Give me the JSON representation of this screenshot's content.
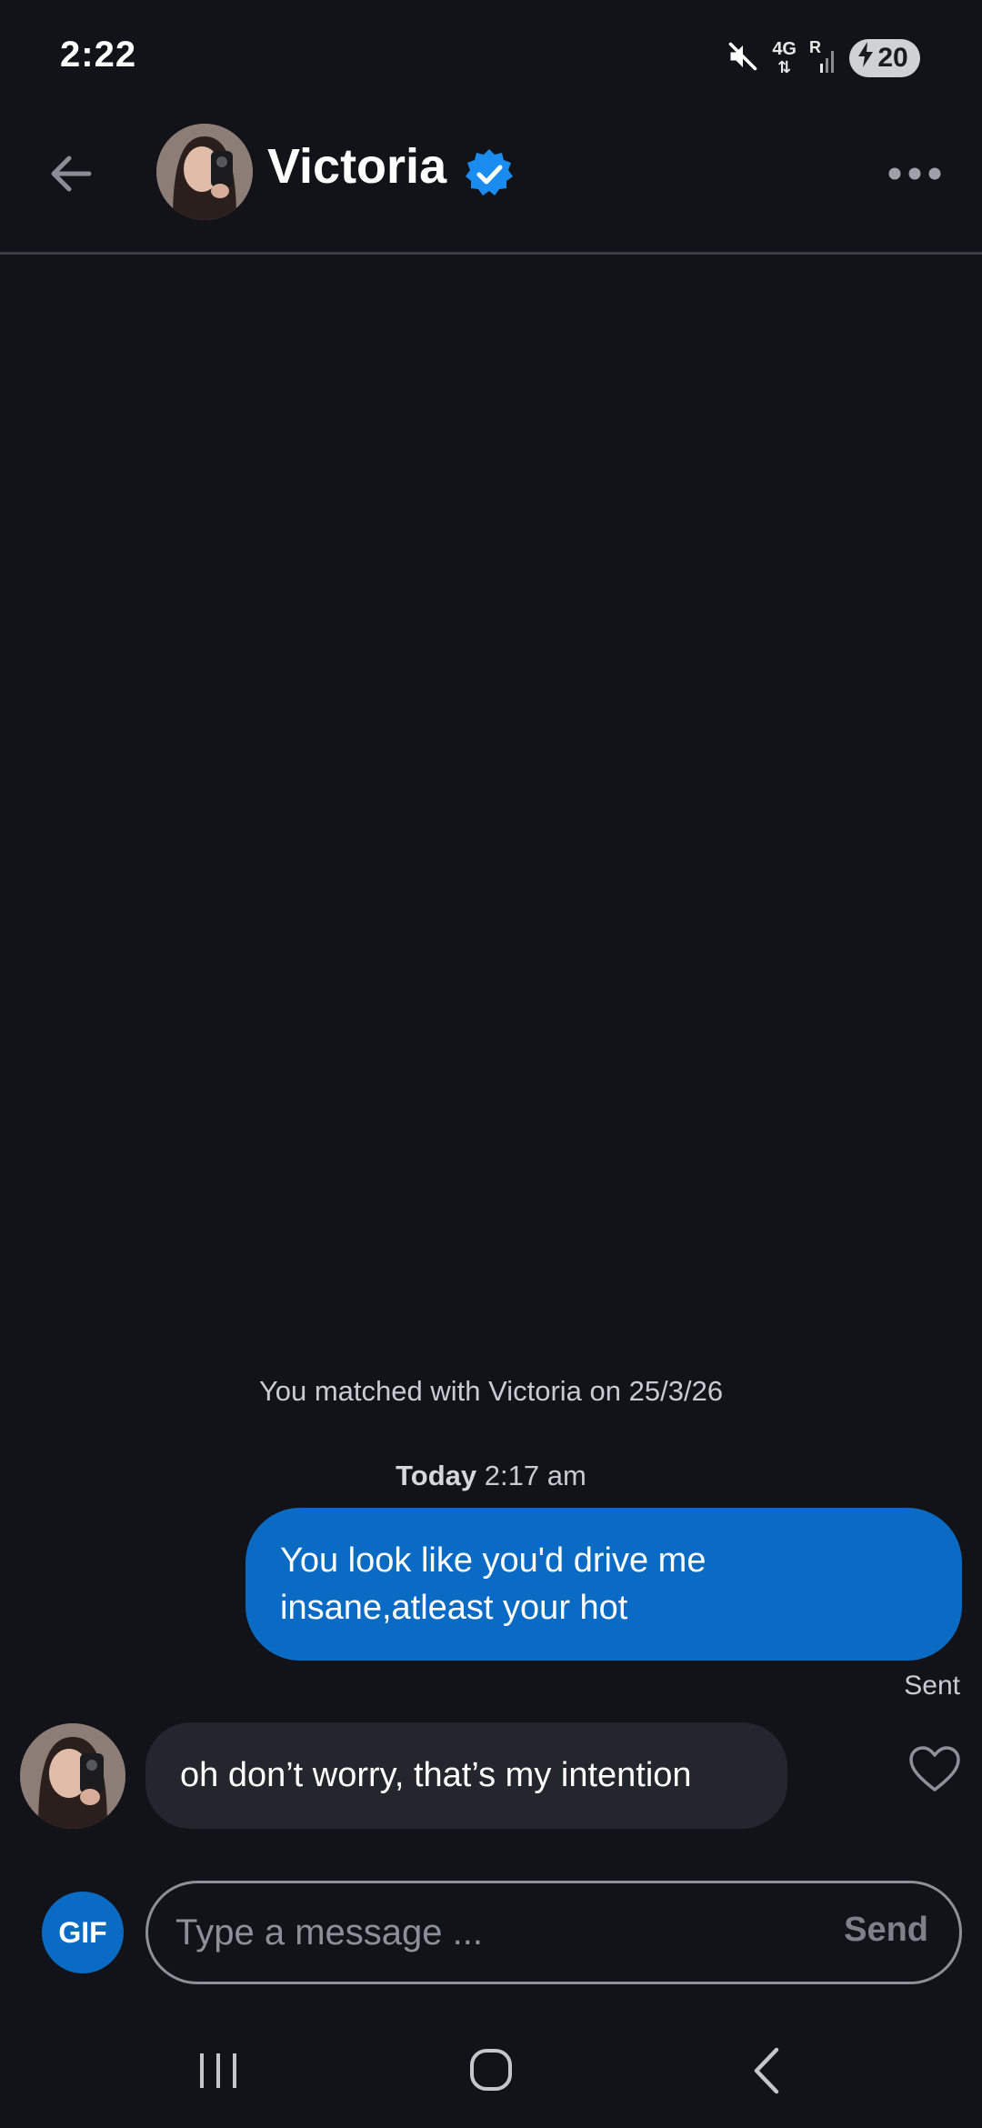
{
  "status_bar": {
    "time": "2:22",
    "network_top": "4G",
    "roaming": "R",
    "battery_level": "20"
  },
  "header": {
    "name": "Victoria",
    "verified": true
  },
  "conversation": {
    "match_note": "You matched with Victoria on 25/3/26",
    "day_label": "Today",
    "time_label": "2:17 am",
    "sent_message": "You look like you'd drive me insane,atleast your hot",
    "sent_status": "Sent",
    "received_message": "oh don’t worry, that’s my intention"
  },
  "composer": {
    "gif_label": "GIF",
    "placeholder": "Type a message ...",
    "send_label": "Send"
  },
  "colors": {
    "background": "#111318",
    "accent": "#0a6bc5",
    "received_bubble": "#24262d",
    "muted_text": "#c8cbd1"
  },
  "icons": {
    "back": "arrow-left-icon",
    "verified": "verified-badge-icon",
    "more": "more-horizontal-icon",
    "like": "heart-outline-icon",
    "mute": "mute-icon",
    "signal": "signal-icon",
    "nav_recents": "recents-icon",
    "nav_home": "home-icon",
    "nav_back": "chevron-left-icon"
  }
}
